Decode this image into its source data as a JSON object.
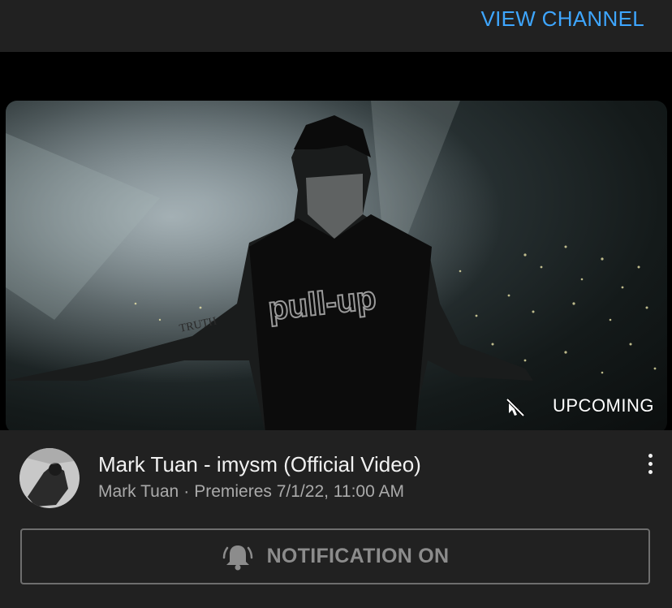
{
  "header": {
    "view_channel_label": "VIEW CHANNEL"
  },
  "player": {
    "status_label": "UPCOMING",
    "thumbnail_text": {
      "shirt": "pull-up",
      "tattoo": "TRUTH"
    }
  },
  "video": {
    "title": "Mark Tuan - imysm (Official Video)",
    "channel": "Mark Tuan",
    "separator": "·",
    "premiere": "Premieres 7/1/22, 11:00 AM"
  },
  "notification": {
    "label": "NOTIFICATION ON"
  },
  "colors": {
    "accent": "#3ea6ff",
    "background": "#212121",
    "muted": "#aaaaaa"
  },
  "icons": [
    "no-cursor-icon",
    "more-vert-icon",
    "bell-ringing-icon",
    "channel-avatar"
  ]
}
